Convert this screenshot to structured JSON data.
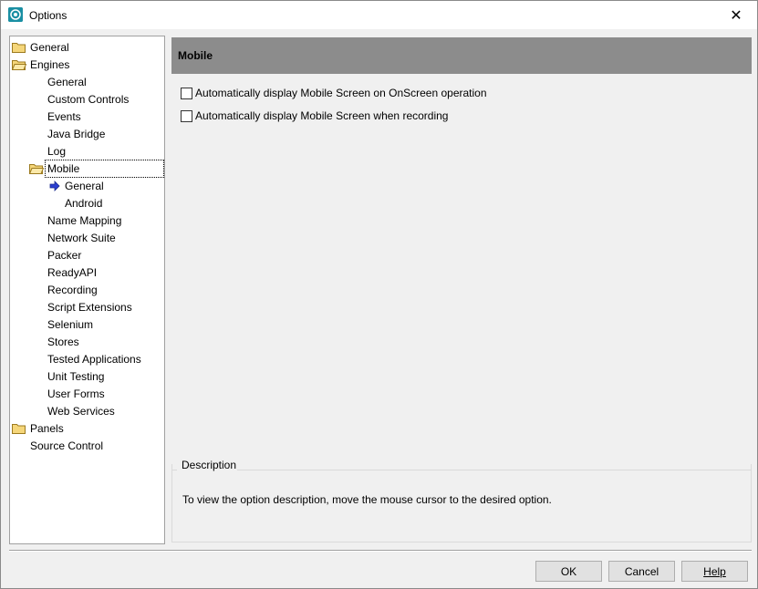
{
  "window": {
    "title": "Options",
    "icon": "options-app-icon"
  },
  "tree": {
    "items": [
      {
        "label": "General",
        "level": 0,
        "folder": true
      },
      {
        "label": "Engines",
        "level": 0,
        "folder": true,
        "open": true
      },
      {
        "label": "General",
        "level": 1
      },
      {
        "label": "Custom Controls",
        "level": 1
      },
      {
        "label": "Events",
        "level": 1
      },
      {
        "label": "Java Bridge",
        "level": 1
      },
      {
        "label": "Log",
        "level": 1
      },
      {
        "label": "Mobile",
        "level": 1,
        "folder": true,
        "open": true,
        "selected": true
      },
      {
        "label": "General",
        "level": 2,
        "current": true
      },
      {
        "label": "Android",
        "level": 2
      },
      {
        "label": "Name Mapping",
        "level": 1
      },
      {
        "label": "Network Suite",
        "level": 1
      },
      {
        "label": "Packer",
        "level": 1
      },
      {
        "label": "ReadyAPI",
        "level": 1
      },
      {
        "label": "Recording",
        "level": 1
      },
      {
        "label": "Script Extensions",
        "level": 1
      },
      {
        "label": "Selenium",
        "level": 1
      },
      {
        "label": "Stores",
        "level": 1
      },
      {
        "label": "Tested Applications",
        "level": 1
      },
      {
        "label": "Unit Testing",
        "level": 1
      },
      {
        "label": "User Forms",
        "level": 1
      },
      {
        "label": "Web Services",
        "level": 1
      },
      {
        "label": "Panels",
        "level": 0,
        "folder": true
      },
      {
        "label": "Source Control",
        "level": 0
      }
    ]
  },
  "panel": {
    "title": "Mobile",
    "options": [
      {
        "label": "Automatically display Mobile Screen on OnScreen operation",
        "checked": false
      },
      {
        "label": "Automatically display Mobile Screen when recording",
        "checked": false
      }
    ]
  },
  "description": {
    "legend": "Description",
    "text": "To view the option description, move the mouse cursor to the desired option."
  },
  "buttons": {
    "ok": "OK",
    "cancel": "Cancel",
    "help": "Help"
  },
  "colors": {
    "panel_header": "#8c8c8c",
    "folder": "#f5d67a",
    "arrow": "#2b3fd1"
  }
}
